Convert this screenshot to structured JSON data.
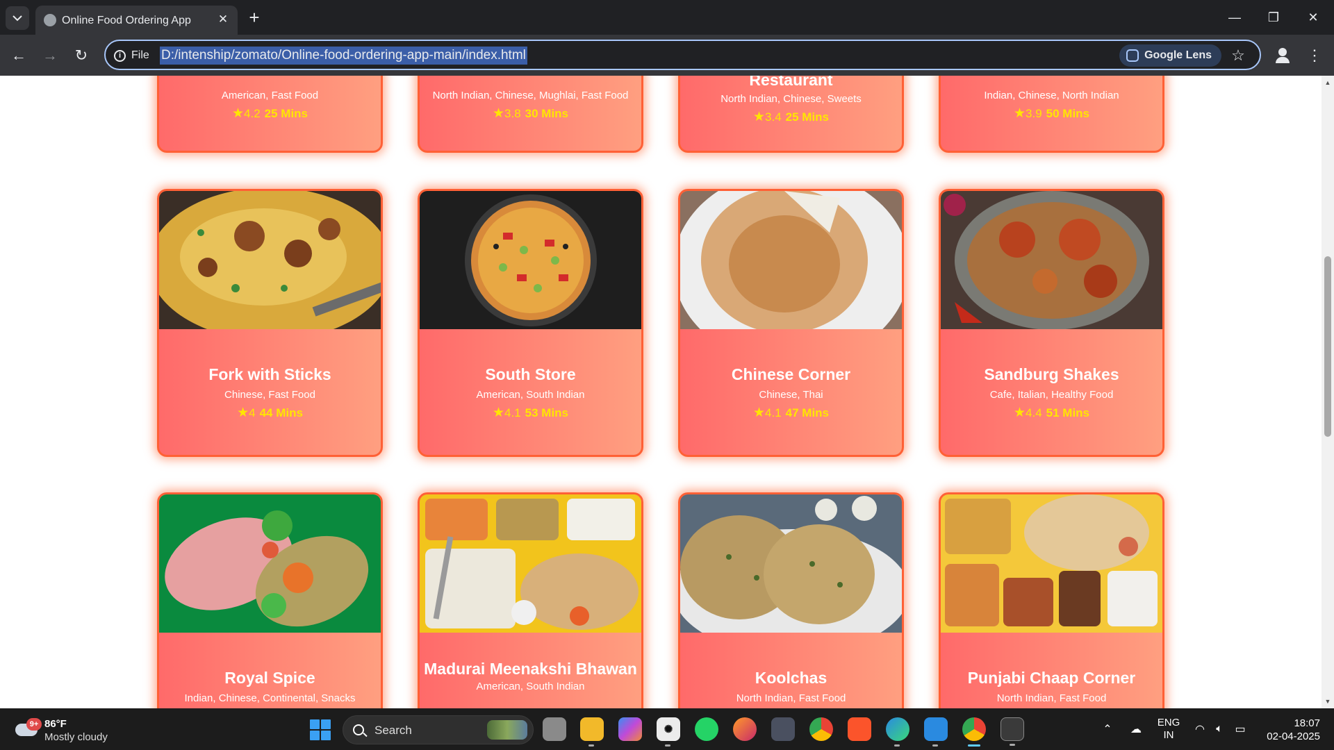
{
  "browser": {
    "tab_title": "Online Food Ordering App",
    "url_scheme": "File",
    "url": "D:/intenship/zomato/Online-food-ordering-app-main/index.html",
    "lens_label": "Google Lens"
  },
  "restaurants_top_row": [
    {
      "name": "",
      "cuisine": "American, Fast Food",
      "rating": "4.2",
      "time": "25 Mins"
    },
    {
      "name": "",
      "cuisine": "North Indian, Chinese, Mughlai, Fast Food",
      "rating": "3.8",
      "time": "30 Mins"
    },
    {
      "name": "Restaurant",
      "cuisine": "North Indian, Chinese, Sweets",
      "rating": "3.4",
      "time": "25 Mins"
    },
    {
      "name": "",
      "cuisine": "Indian, Chinese, North Indian",
      "rating": "3.9",
      "time": "50 Mins"
    }
  ],
  "restaurants_middle_row": [
    {
      "name": "Fork with Sticks",
      "cuisine": "Chinese, Fast Food",
      "rating": "4",
      "time": "44 Mins",
      "photo": "biryani"
    },
    {
      "name": "South Store",
      "cuisine": "American, South Indian",
      "rating": "4.1",
      "time": "53 Mins",
      "photo": "pizza"
    },
    {
      "name": "Chinese Corner",
      "cuisine": "Chinese, Thai",
      "rating": "4.1",
      "time": "47 Mins",
      "photo": "dosa"
    },
    {
      "name": "Sandburg Shakes",
      "cuisine": "Cafe, Italian, Healthy Food",
      "rating": "4.4",
      "time": "51 Mins",
      "photo": "chicken-biryani"
    }
  ],
  "restaurants_bottom_row": [
    {
      "name": "Royal Spice",
      "cuisine": "Indian, Chinese, Continental, Snacks",
      "photo": "wrap"
    },
    {
      "name": "Madurai Meenakshi Bhawan",
      "cuisine": "American, South Indian",
      "photo": "thali"
    },
    {
      "name": "Koolchas",
      "cuisine": "North Indian, Fast Food",
      "photo": "paratha"
    },
    {
      "name": "Punjabi Chaap Corner",
      "cuisine": "North Indian, Fast Food",
      "photo": "punjabi-thali"
    }
  ],
  "star_glyph": "★",
  "taskbar": {
    "weather_badge": "9+",
    "temperature": "86°F",
    "condition": "Mostly cloudy",
    "search_label": "Search",
    "lang_primary": "ENG",
    "lang_secondary": "IN",
    "time": "18:07",
    "date": "02-04-2025"
  },
  "colors": {
    "card_gradient_start": "#ff6a6a",
    "card_gradient_end": "#ff9f80",
    "card_border": "#ff6035",
    "rating_color": "#ffe600"
  }
}
